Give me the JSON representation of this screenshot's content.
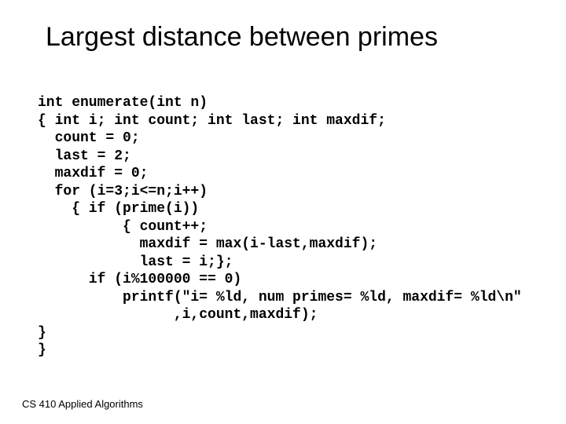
{
  "title": "Largest distance between primes",
  "code": "int enumerate(int n)\n{ int i; int count; int last; int maxdif;\n  count = 0;\n  last = 2;\n  maxdif = 0;\n  for (i=3;i<=n;i++)\n    { if (prime(i))\n          { count++;\n            maxdif = max(i-last,maxdif);\n            last = i;};\n      if (i%100000 == 0)\n          printf(\"i= %ld, num primes= %ld, maxdif= %ld\\n\"\n                ,i,count,maxdif);\n}\n}",
  "footer": "CS 410  Applied Algorithms"
}
